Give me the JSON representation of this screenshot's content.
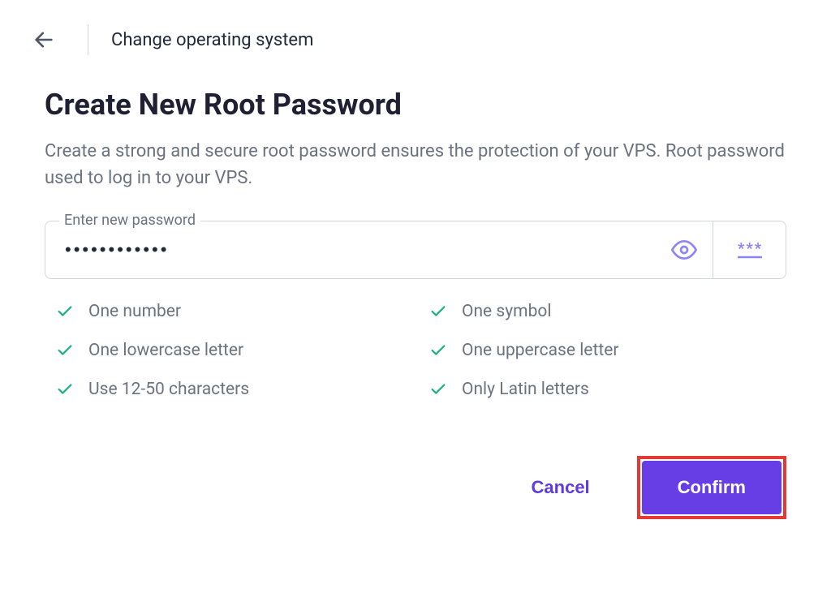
{
  "header": {
    "title": "Change operating system"
  },
  "main": {
    "heading": "Create New Root Password",
    "description": "Create a strong and secure root password ensures the protection of your VPS. Root password used to log in to your VPS."
  },
  "password_field": {
    "label": "Enter new password",
    "value": "••••••••••••"
  },
  "requirements": {
    "items": [
      {
        "text": "One number"
      },
      {
        "text": "One symbol"
      },
      {
        "text": "One lowercase letter"
      },
      {
        "text": "One uppercase letter"
      },
      {
        "text": "Use 12-50 characters"
      },
      {
        "text": "Only Latin letters"
      }
    ]
  },
  "actions": {
    "cancel": "Cancel",
    "confirm": "Confirm"
  },
  "colors": {
    "accent": "#673de6",
    "success": "#10b981",
    "highlight_border": "#e53935"
  }
}
